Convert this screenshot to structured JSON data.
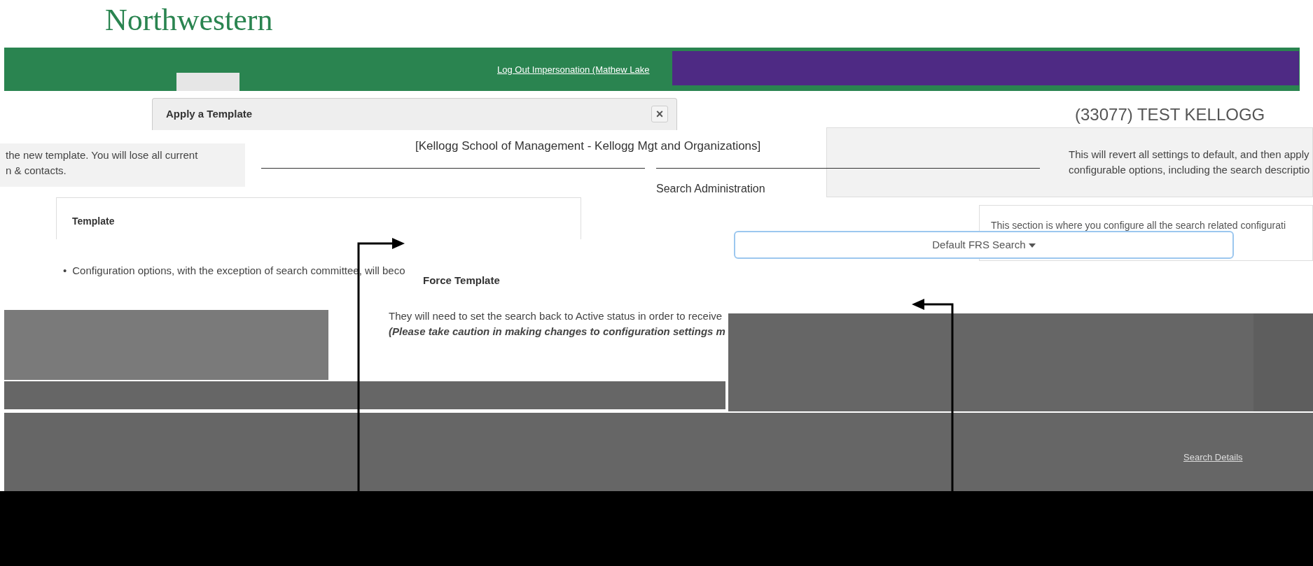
{
  "header": {
    "logo": "Northwestern"
  },
  "nav": {
    "impersonation_link": "Log Out Impersonation (Mathew Lake"
  },
  "page": {
    "search_title": "(33077) TEST KELLOGG",
    "department": "[Kellogg School of Management - Kellogg Mgt and Organizations]",
    "section_heading": "Search Administration",
    "revert_note": [
      "This will revert all settings to default, and then apply",
      "configurable options, including the search descriptio"
    ],
    "config_note": "This section is where you configure all the search related configurati",
    "template_dropdown": "Default FRS Search",
    "bottom_link": "Search Details"
  },
  "modal": {
    "title": "Apply a Template",
    "close": "×",
    "warning": [
      "the new template. You will lose all current",
      "n & contacts."
    ],
    "template_label": "Template",
    "bullet_marker": "•",
    "bullet": "Configuration options, with the exception of search committee, will beco",
    "force_label": "Force Template",
    "status_note": "They will need to set the search back to Active status in order to receive",
    "caution": "(Please take caution in making changes to configuration settings m"
  }
}
